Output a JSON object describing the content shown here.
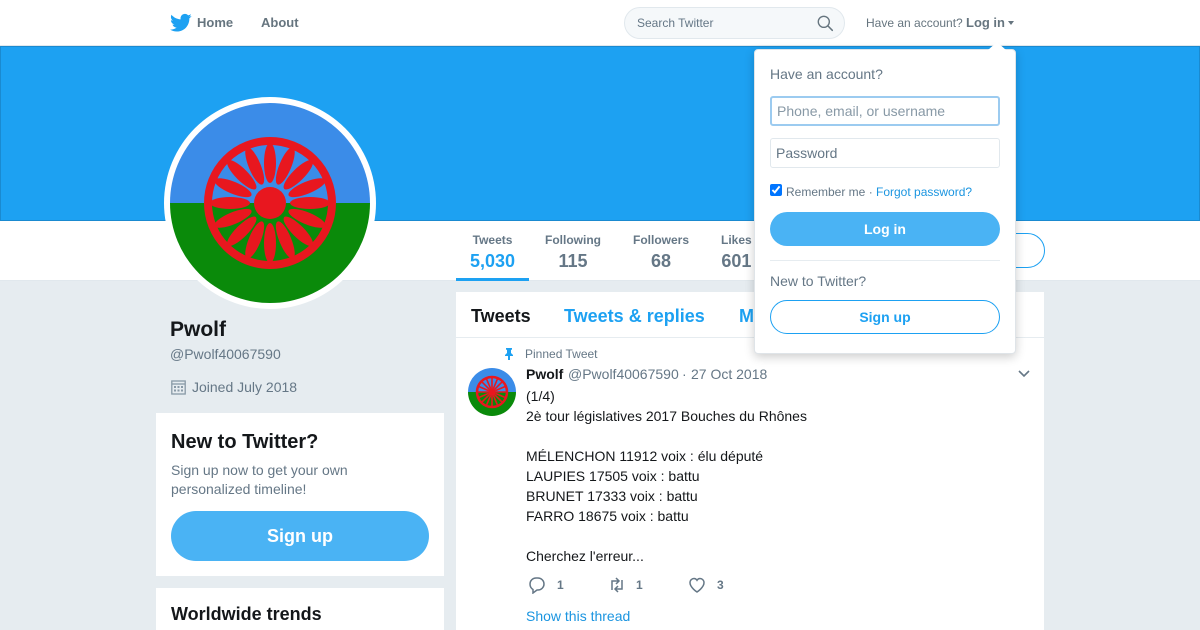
{
  "colors": {
    "accent": "#1da1f2",
    "banner": "#1da1f2",
    "button_fill": "#4ab3f4",
    "page_bg": "#e6ecf0",
    "flag_blue": "#3b8ce8",
    "flag_green": "#0a8a0a",
    "flag_wheel": "#e8171f"
  },
  "nav": {
    "logo_icon": "twitter-bird-icon",
    "home_label": "Home",
    "about_label": "About",
    "search_placeholder": "Search Twitter",
    "have_account": "Have an account?",
    "login_label": "Log in"
  },
  "profile": {
    "name": "Pwolf",
    "handle": "@Pwolf40067590",
    "joined": "Joined July 2018",
    "avatar_icon": "romani-flag-avatar"
  },
  "stats": [
    {
      "label": "Tweets",
      "value": "5,030"
    },
    {
      "label": "Following",
      "value": "115"
    },
    {
      "label": "Followers",
      "value": "68"
    },
    {
      "label": "Likes",
      "value": "601"
    }
  ],
  "signup_card": {
    "title": "New to Twitter?",
    "text": "Sign up now to get your own personalized timeline!",
    "button": "Sign up"
  },
  "trends": {
    "title": "Worldwide trends"
  },
  "timeline": {
    "tabs": [
      "Tweets",
      "Tweets & replies",
      "M"
    ],
    "pinned_label": "Pinned Tweet",
    "tweet": {
      "name": "Pwolf",
      "handle": "@Pwolf40067590",
      "separator": "·",
      "date": "27 Oct 2018",
      "text": "(1/4)\n2è tour législatives 2017 Bouches du Rhônes\n\nMÉLENCHON 11912 voix : élu député\nLAUPIES 17505 voix : battu\nBRUNET 17333 voix : battu\nFARRO 18675 voix : battu\n\nCherchez l'erreur...",
      "replies": "1",
      "retweets": "1",
      "likes": "3",
      "show_thread": "Show this thread"
    }
  },
  "login_dropdown": {
    "title": "Have an account?",
    "username_placeholder": "Phone, email, or username",
    "password_placeholder": "Password",
    "remember_label": "Remember me ·",
    "remember_checked": true,
    "forgot_label": "Forgot password?",
    "login_button": "Log in",
    "new_label": "New to Twitter?",
    "signup_button": "Sign up"
  }
}
